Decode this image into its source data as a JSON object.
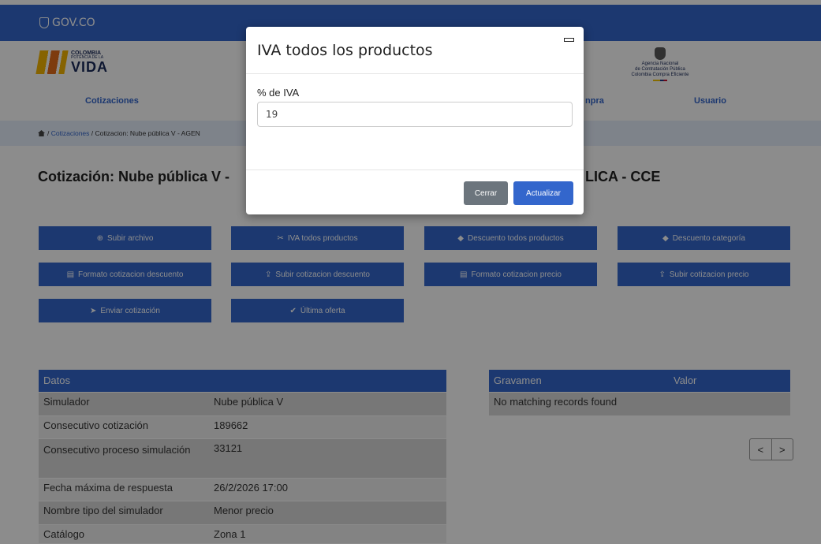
{
  "gov": {
    "logo": "GOV.CO"
  },
  "header": {
    "logo_line1": "COLOMBIA",
    "logo_line2": "POTENCIA DE LA",
    "logo_line3": "VIDA",
    "agency_line1": "Agencia Nacional",
    "agency_line2": "de Contratación Pública",
    "agency_line3": "Colombia Compra Eficiente",
    "nav": {
      "cotizaciones": "Cotizaciones",
      "compra_partial": "npra",
      "usuario": "Usuario"
    }
  },
  "breadcrumb": {
    "link": "Cotizaciones",
    "text": "/ Cotizacion: Nube pública V - AGEN",
    "sep": "/"
  },
  "title": {
    "left": "Cotización: Nube pública V -",
    "right": "LICA - CCE"
  },
  "actions": [
    {
      "label": "Subir archivo",
      "icon": "⊕"
    },
    {
      "label": "IVA todos productos",
      "icon": "✂"
    },
    {
      "label": "Descuento todos productos",
      "icon": "◆"
    },
    {
      "label": "Descuento categoría",
      "icon": "◆"
    },
    {
      "label": "Formato cotizacion descuento",
      "icon": "▤"
    },
    {
      "label": "Subir cotizacion descuento",
      "icon": "⇪"
    },
    {
      "label": "Formato cotizacion precio",
      "icon": "▤"
    },
    {
      "label": "Subir cotizacion precio",
      "icon": "⇪"
    },
    {
      "label": "Enviar cotización",
      "icon": "➤"
    },
    {
      "label": "Última oferta",
      "icon": "✔"
    }
  ],
  "datos": {
    "header": "Datos",
    "rows": [
      {
        "k": "Simulador",
        "v": "Nube pública V"
      },
      {
        "k": "Consecutivo cotización",
        "v": "189662"
      },
      {
        "k": "Consecutivo proceso simulación",
        "v": "33121"
      },
      {
        "k": "Fecha máxima de respuesta",
        "v": "26/2/2026 17:00"
      },
      {
        "k": "Nombre tipo del simulador",
        "v": "Menor precio"
      },
      {
        "k": "Catálogo",
        "v": "Zona 1"
      }
    ]
  },
  "gravamen": {
    "col1": "Gravamen",
    "col2": "Valor",
    "empty": "No matching records found"
  },
  "pager": {
    "prev": "<",
    "next": ">"
  },
  "modal": {
    "title": "IVA todos los productos",
    "field_label": "% de IVA",
    "field_value": "19",
    "close_label": "Cerrar",
    "update_label": "Actualizar"
  }
}
